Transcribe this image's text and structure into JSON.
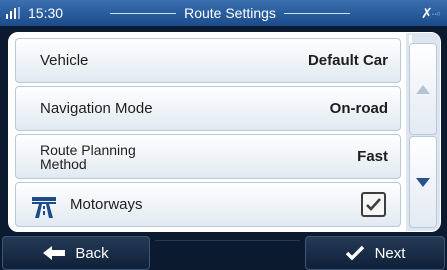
{
  "status": {
    "time": "15:30",
    "signal_icon": "signal-icon",
    "satellite_icon": "satellite-icon"
  },
  "header": {
    "title": "Route Settings"
  },
  "settings": {
    "vehicle": {
      "label": "Vehicle",
      "value": "Default Car"
    },
    "navigation_mode": {
      "label": "Navigation Mode",
      "value": "On-road"
    },
    "route_planning": {
      "label_line1": "Route Planning",
      "label_line2": "Method",
      "value": "Fast"
    },
    "motorways": {
      "label": "Motorways",
      "icon": "motorway-icon",
      "checked": true
    }
  },
  "scrollbar": {
    "up_icon": "arrow-up-icon",
    "down_icon": "arrow-down-icon"
  },
  "footer": {
    "back_label": "Back",
    "next_label": "Next"
  },
  "colors": {
    "header": "#2a5a9c",
    "accent": "#2a4f8e",
    "panel": "#ffffff",
    "footer": "#0b1a2e"
  }
}
